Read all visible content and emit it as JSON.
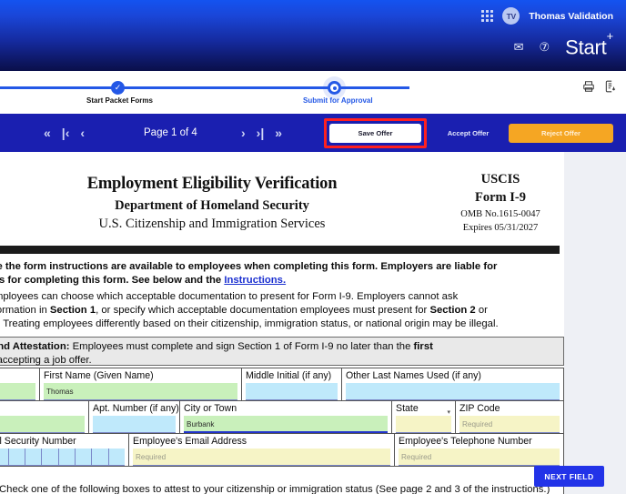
{
  "topbar": {
    "apps_icon": "grid-apps-icon",
    "avatar_initials": "TV",
    "user_name": "Thomas Validation",
    "mail_icon": "✉",
    "help_icon": "⑦",
    "brand_name": "Start",
    "brand_sup": "+"
  },
  "stepper": {
    "steps": [
      {
        "label": "Start Packet Forms",
        "state": "done",
        "check": "✓"
      },
      {
        "label": "Submit for Approval",
        "state": "current"
      }
    ],
    "print_icon": "print-icon",
    "download_icon": "document-download-icon"
  },
  "toolbar": {
    "first_page_icon": "«",
    "prev_jump_icon": "|‹",
    "prev_icon": "‹",
    "page_info": "Page 1 of 4",
    "next_icon": "›",
    "next_jump_icon": "›|",
    "last_page_icon": "»",
    "save_label": "Save Offer",
    "accept_label": "Accept Offer",
    "reject_label": "Reject Offer",
    "highlight_color": "#ff2020",
    "reject_color": "#f5a623",
    "bar_color": "#1a1fb0"
  },
  "document": {
    "title_line1": "Employment Eligibility Verification",
    "title_line2": "Department of Homeland Security",
    "title_line3": "U.S. Citizenship and Immigration Services",
    "agency": "USCIS",
    "form_number": "Form I-9",
    "omb": "OMB No.1615-0047",
    "expires": "Expires 05/31/2027",
    "para1_a": "nsure the form instructions are available to employees when completing this form.  Employers are liable for",
    "para1_b": "ments for completing this form.  See below and the ",
    "para1_link": "Instructions.",
    "para2_l1": "All employees can choose which acceptable documentation to present for Form I-9.  Employers cannot ask",
    "para2_l2_a": "fy information in ",
    "para2_l2_b": "Section 1",
    "para2_l2_c": ", or specify which acceptable documentation employees must present for ",
    "para2_l2_d": "Section 2",
    "para2_l2_e": " or",
    "para2_l3": "ehire.  Treating employees differently based on their citizenship, immigration status, or national origin may be illegal.",
    "attest_a": "on and Attestation:",
    "attest_b": " Employees must complete and sign Section 1 of Form I-9 no later than the ",
    "attest_c": "first",
    "attest_d": "fore accepting a job offer.",
    "bottom_note": "Check one of the following boxes to attest to your citizenship or immigration status (See page 2 and 3 of the instructions.)"
  },
  "form_fields": {
    "row1": [
      {
        "name": "last-name",
        "label": "",
        "value": "",
        "style": "green"
      },
      {
        "name": "first-name",
        "label": "First Name (Given Name)",
        "value": "Thomas",
        "style": "green"
      },
      {
        "name": "middle-initial",
        "label": "Middle Initial (if any)",
        "value": "",
        "style": "blue"
      },
      {
        "name": "other-last-names",
        "label": "Other Last Names Used (if any)",
        "value": "",
        "style": "blue"
      }
    ],
    "row2": [
      {
        "name": "address",
        "label": "",
        "value": "",
        "style": "green"
      },
      {
        "name": "apt-number",
        "label": "Apt. Number (if any)",
        "value": "",
        "style": "blue"
      },
      {
        "name": "city-or-town",
        "label": "City or Town",
        "value": "Burbank",
        "style": "green-active"
      },
      {
        "name": "state",
        "label": "State",
        "value": "",
        "style": "yellow-select"
      },
      {
        "name": "zip-code",
        "label": "ZIP Code",
        "value": "Required",
        "style": "yellow-required"
      }
    ],
    "row3": [
      {
        "name": "social-security-number",
        "label": "Social Security Number",
        "value": "",
        "style": "ssn"
      },
      {
        "name": "employee-email",
        "label": "Employee's Email Address",
        "value": "Required",
        "style": "yellow-required"
      },
      {
        "name": "employee-telephone",
        "label": "Employee's Telephone Number",
        "value": "Required",
        "style": "yellow-required"
      }
    ]
  },
  "next_field": {
    "label": "NEXT FIELD"
  }
}
